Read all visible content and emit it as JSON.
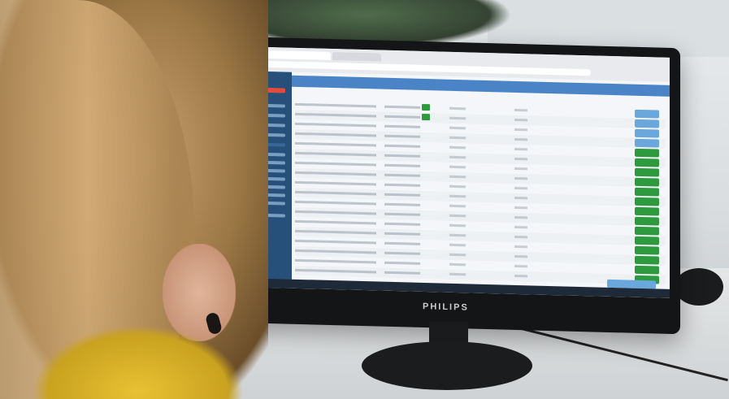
{
  "photo": {
    "monitor_brand": "PHILIPS",
    "colors": {
      "sidebar": "#26507a",
      "banner": "#4a84c6",
      "button_green": "#2d9a3e",
      "button_blue": "#6aa7dc",
      "hair": "#c8a26f",
      "shirt": "#e8c133"
    },
    "icons": [
      "monitor-icon"
    ]
  }
}
